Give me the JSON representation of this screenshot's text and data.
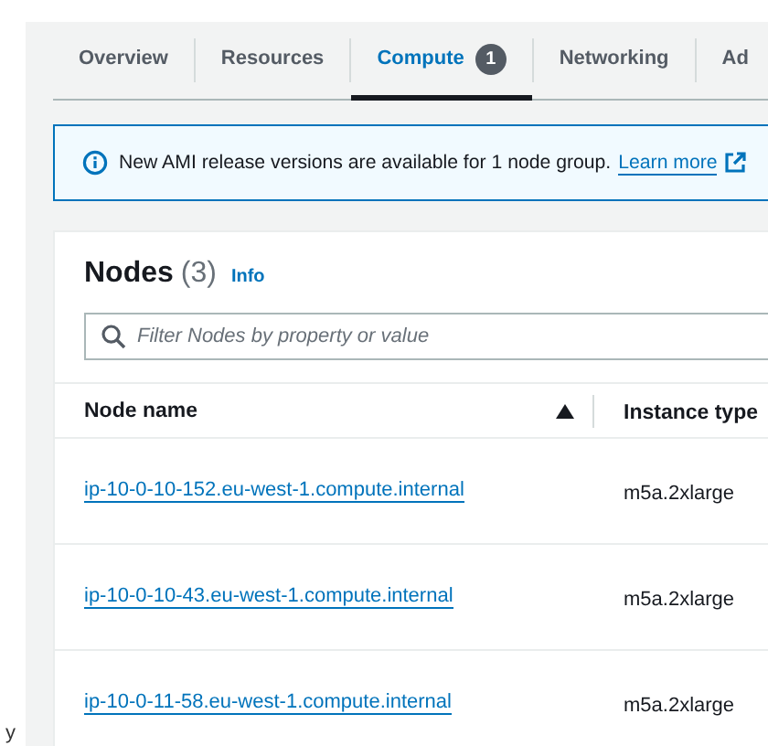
{
  "tabs": [
    {
      "label": "Overview",
      "selected": false
    },
    {
      "label": "Resources",
      "selected": false
    },
    {
      "label": "Compute",
      "selected": true,
      "badge": "1"
    },
    {
      "label": "Networking",
      "selected": false
    },
    {
      "label": "Ad",
      "selected": false
    }
  ],
  "alert": {
    "message": "New AMI release versions are available for 1 node group.",
    "link": "Learn more"
  },
  "nodes": {
    "title": "Nodes",
    "count": "(3)",
    "info": "Info",
    "filter": {
      "placeholder": "Filter Nodes by property or value"
    },
    "columns": [
      "Node name",
      "Instance type"
    ],
    "rows": [
      {
        "node_name": "ip-10-0-10-152.eu-west-1.compute.internal",
        "instance_type": "m5a.2xlarge"
      },
      {
        "node_name": "ip-10-0-10-43.eu-west-1.compute.internal",
        "instance_type": "m5a.2xlarge"
      },
      {
        "node_name": "ip-10-0-11-58.eu-west-1.compute.internal",
        "instance_type": "m5a.2xlarge"
      }
    ]
  },
  "margin_text": "y"
}
